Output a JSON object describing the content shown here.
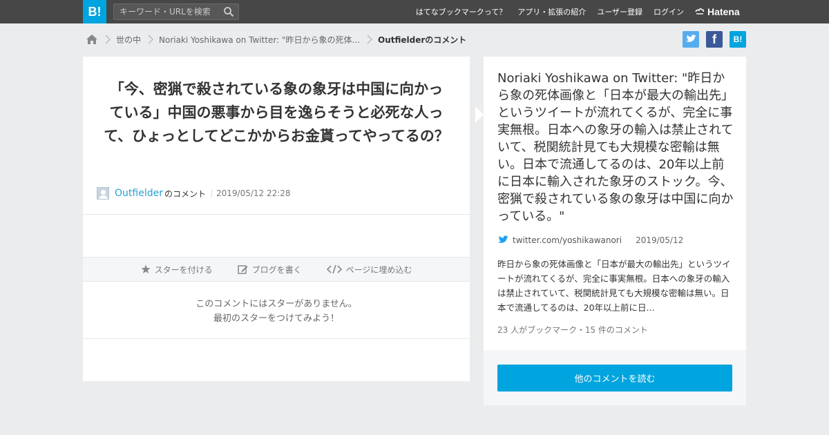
{
  "header": {
    "logo": "B!",
    "search_placeholder": "キーワード・URLを検索",
    "nav": [
      "はてなブックマークって？",
      "アプリ・拡張の紹介",
      "ユーザー登録",
      "ログイン"
    ],
    "brand": "Hatena"
  },
  "breadcrumb": {
    "items": [
      "世の中",
      "Noriaki Yoshikawa on Twitter: \"昨日から象の死体...",
      "Outfielderのコメント"
    ]
  },
  "share": {
    "twitter": "",
    "facebook": "f",
    "hatena": "B!"
  },
  "comment": {
    "text": "「今、密猟で殺されている象の象牙は中国に向かっている」中国の悪事から目を逸らそうと必死な人って、ひょっとしてどこかからお金貰ってやってるの？",
    "username": "Outfielder",
    "no_comment": "のコメント",
    "date": "2019/05/12 22:28",
    "actions": [
      "スターを付ける",
      "ブログを書く",
      "ページに埋め込む"
    ],
    "empty_star_line1": "このコメントにはスターがありません。",
    "empty_star_line2": "最初のスターをつけてみよう！"
  },
  "entry": {
    "title": "Noriaki Yoshikawa on Twitter: \"昨日から象の死体画像と「日本が最大の輸出先」というツイートが流れてくるが、完全に事実無根。日本への象牙の輸入は禁止されていて、税関統計見ても大規模な密輸は無い。日本で流通してるのは、20年以上前に日本に輸入された象牙のストック。今、密猟で殺されている象の象牙は中国に向かっている。\"",
    "source_url": "twitter.com/yoshikawanori",
    "source_date": "2019/05/12",
    "summary": "昨日から象の死体画像と「日本が最大の輸出先」というツイートが流れてくるが、完全に事実無根。日本への象牙の輸入は禁止されていて、税関統計見ても大規模な密輸は無い。日本で流通してるのは、20年以上前に日...",
    "counts": "23 人がブックマーク・15 件のコメント",
    "read_more": "他のコメントを読む"
  },
  "colors": {
    "accent": "#00a4de",
    "header_bg": "#474747",
    "link": "#25a1d4",
    "twitter": "#55acee",
    "facebook": "#3b5998"
  }
}
